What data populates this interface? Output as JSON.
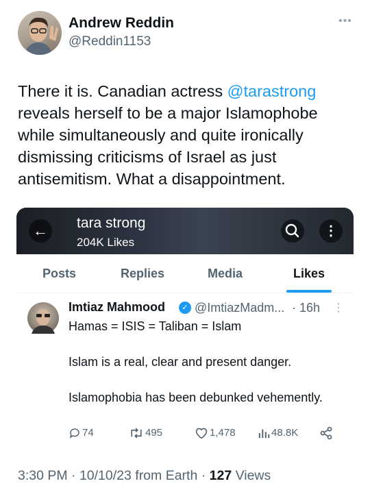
{
  "author": {
    "name": "Andrew Reddin",
    "handle": "@Reddin1153"
  },
  "tweet": {
    "text_before": "There it is. Canadian actress ",
    "mention": "@tarastrong",
    "text_after": " reveals herself to be a major Islamophobe while simultaneously and quite ironically dismissing criticisms of Israel as just antisemitism. What a disappointment."
  },
  "embedded": {
    "profile_name": "tara strong",
    "profile_likes": "204K Likes",
    "tabs": [
      {
        "label": "Posts"
      },
      {
        "label": "Replies"
      },
      {
        "label": "Media"
      },
      {
        "label": "Likes"
      }
    ],
    "active_tab": "Likes",
    "liked_post": {
      "name": "Imtiaz Mahmood",
      "handle": "@ImtiazMadm...",
      "time": "· 16h",
      "text": "Hamas = ISIS = Taliban = Islam\n\nIslam is a real, clear and present danger.\n\nIslamophobia has been debunked vehemently.",
      "replies": "74",
      "reposts": "495",
      "likes": "1,478",
      "views": "48.8K"
    }
  },
  "footer": {
    "time_date": "3:30 PM · 10/10/23 from Earth · ",
    "views_count": "127",
    "views_label": " Views"
  },
  "colors": {
    "accent": "#1d9bf0",
    "secondary_text": "#536471",
    "primary_text": "#0f1419"
  },
  "icons": [
    "more-icon",
    "back-arrow-icon",
    "search-icon",
    "vertical-more-icon",
    "verified-badge-icon",
    "reply-icon",
    "repost-icon",
    "like-icon",
    "views-icon",
    "share-icon"
  ]
}
